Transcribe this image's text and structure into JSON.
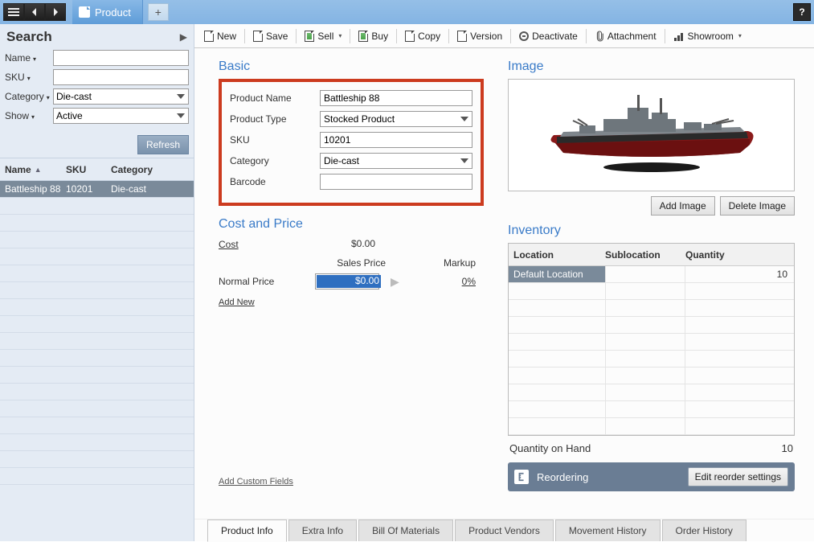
{
  "titlebar": {
    "tab_label": "Product"
  },
  "search": {
    "title": "Search",
    "name_label": "Name",
    "name_value": "",
    "sku_label": "SKU",
    "sku_value": "",
    "category_label": "Category",
    "category_value": "Die-cast",
    "show_label": "Show",
    "show_value": "Active",
    "refresh": "Refresh",
    "grid": {
      "hdr_name": "Name",
      "hdr_sku": "SKU",
      "hdr_category": "Category",
      "rows": [
        {
          "name": "Battleship 88",
          "sku": "10201",
          "category": "Die-cast"
        }
      ]
    }
  },
  "toolbar": {
    "new": "New",
    "save": "Save",
    "sell": "Sell",
    "buy": "Buy",
    "copy": "Copy",
    "version": "Version",
    "deactivate": "Deactivate",
    "attachment": "Attachment",
    "showroom": "Showroom"
  },
  "basic": {
    "title": "Basic",
    "product_name_label": "Product Name",
    "product_name": "Battleship 88",
    "product_type_label": "Product Type",
    "product_type": "Stocked Product",
    "sku_label": "SKU",
    "sku": "10201",
    "category_label": "Category",
    "category": "Die-cast",
    "barcode_label": "Barcode",
    "barcode": ""
  },
  "costprice": {
    "title": "Cost and Price",
    "cost_label": "Cost",
    "cost": "$0.00",
    "sales_price_hdr": "Sales Price",
    "markup_hdr": "Markup",
    "normal_price_label": "Normal Price",
    "normal_price": "$0.00",
    "markup": "0%",
    "add_new": "Add New"
  },
  "add_custom": "Add Custom Fields",
  "image": {
    "title": "Image",
    "add": "Add Image",
    "delete": "Delete Image"
  },
  "inventory": {
    "title": "Inventory",
    "hdr_location": "Location",
    "hdr_sub": "Sublocation",
    "hdr_qty": "Quantity",
    "rows": [
      {
        "location": "Default Location",
        "sub": "",
        "qty": "10"
      }
    ],
    "qoh_label": "Quantity on Hand",
    "qoh": "10",
    "reorder_label": "Reordering",
    "reorder_btn": "Edit reorder settings"
  },
  "tabs": {
    "t1": "Product Info",
    "t2": "Extra Info",
    "t3": "Bill Of Materials",
    "t4": "Product Vendors",
    "t5": "Movement History",
    "t6": "Order History"
  }
}
